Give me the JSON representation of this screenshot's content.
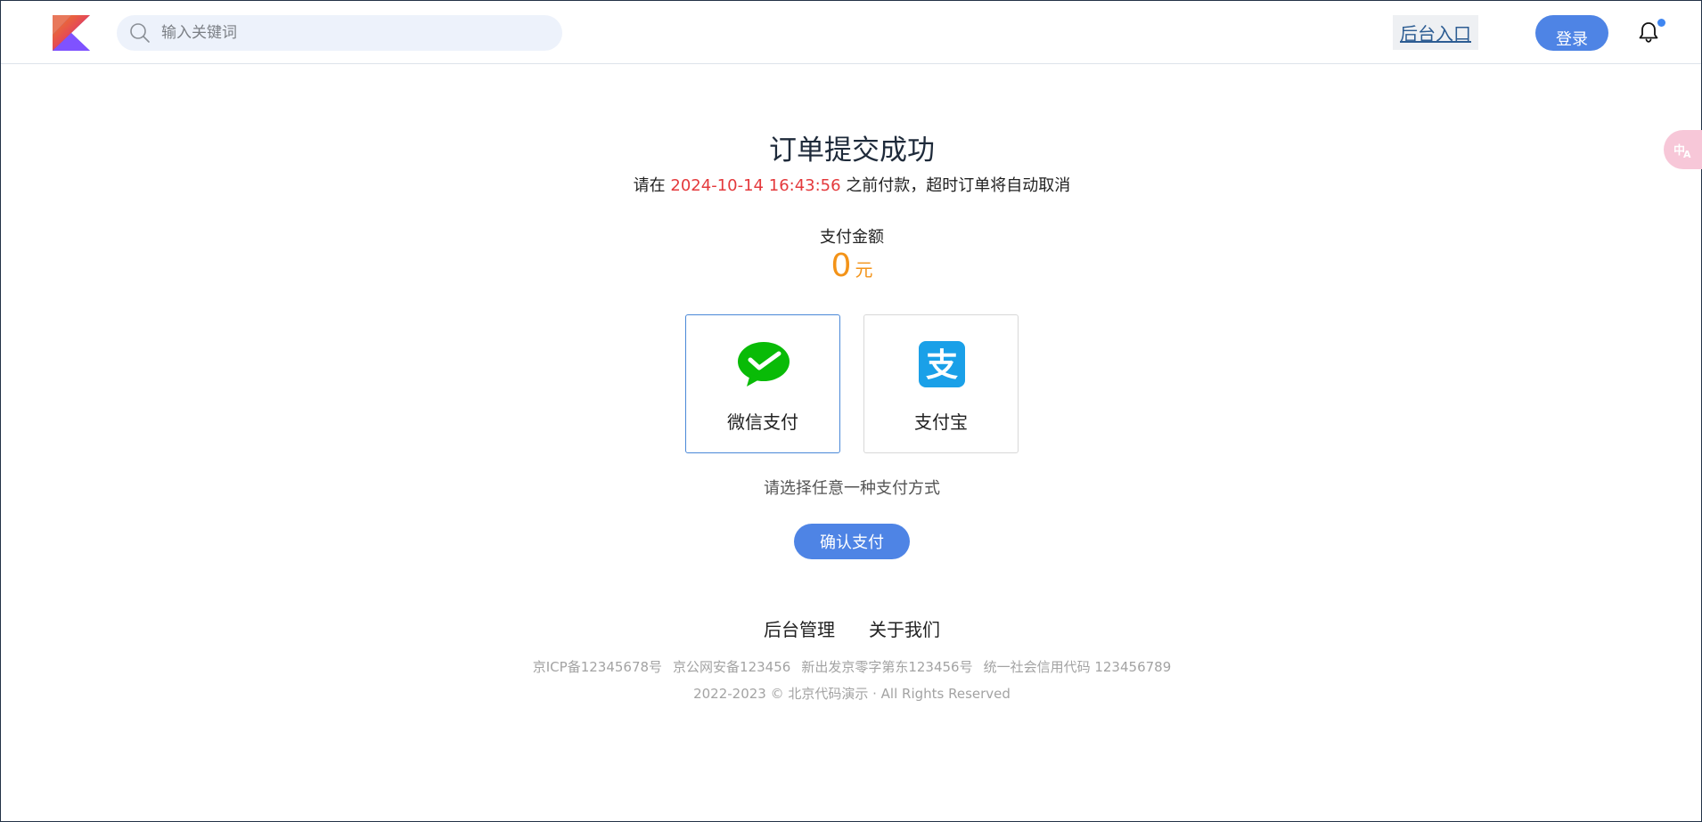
{
  "header": {
    "search_placeholder": "输入关键词",
    "backend_link": "后台入口",
    "login_label": "登录"
  },
  "order": {
    "title": "订单提交成功",
    "deadline_prefix": "请在 ",
    "deadline_time": "2024-10-14 16:43:56",
    "deadline_suffix": " 之前付款，超时订单将自动取消",
    "amount_label": "支付金额",
    "amount_value": "0",
    "amount_unit": "元"
  },
  "payment": {
    "options": [
      {
        "label": "微信支付",
        "icon": "wechat-pay-icon",
        "selected": true
      },
      {
        "label": "支付宝",
        "icon": "alipay-icon",
        "selected": false
      }
    ],
    "hint": "请选择任意一种支付方式",
    "confirm_label": "确认支付"
  },
  "footer": {
    "links": [
      "后台管理",
      "关于我们"
    ],
    "icp": [
      "京ICP备12345678号",
      "京公网安备123456",
      "新出发京零字第东123456号",
      "统一社会信用代码 123456789"
    ],
    "copyright": "2022-2023 © 北京代码演示 · All Rights Reserved"
  },
  "colors": {
    "brand_blue": "#4e84e5",
    "deadline_red": "#e4393c",
    "amount_orange": "#f39318",
    "wechat_green": "#09bb07",
    "alipay_blue": "#1aa0e8"
  }
}
